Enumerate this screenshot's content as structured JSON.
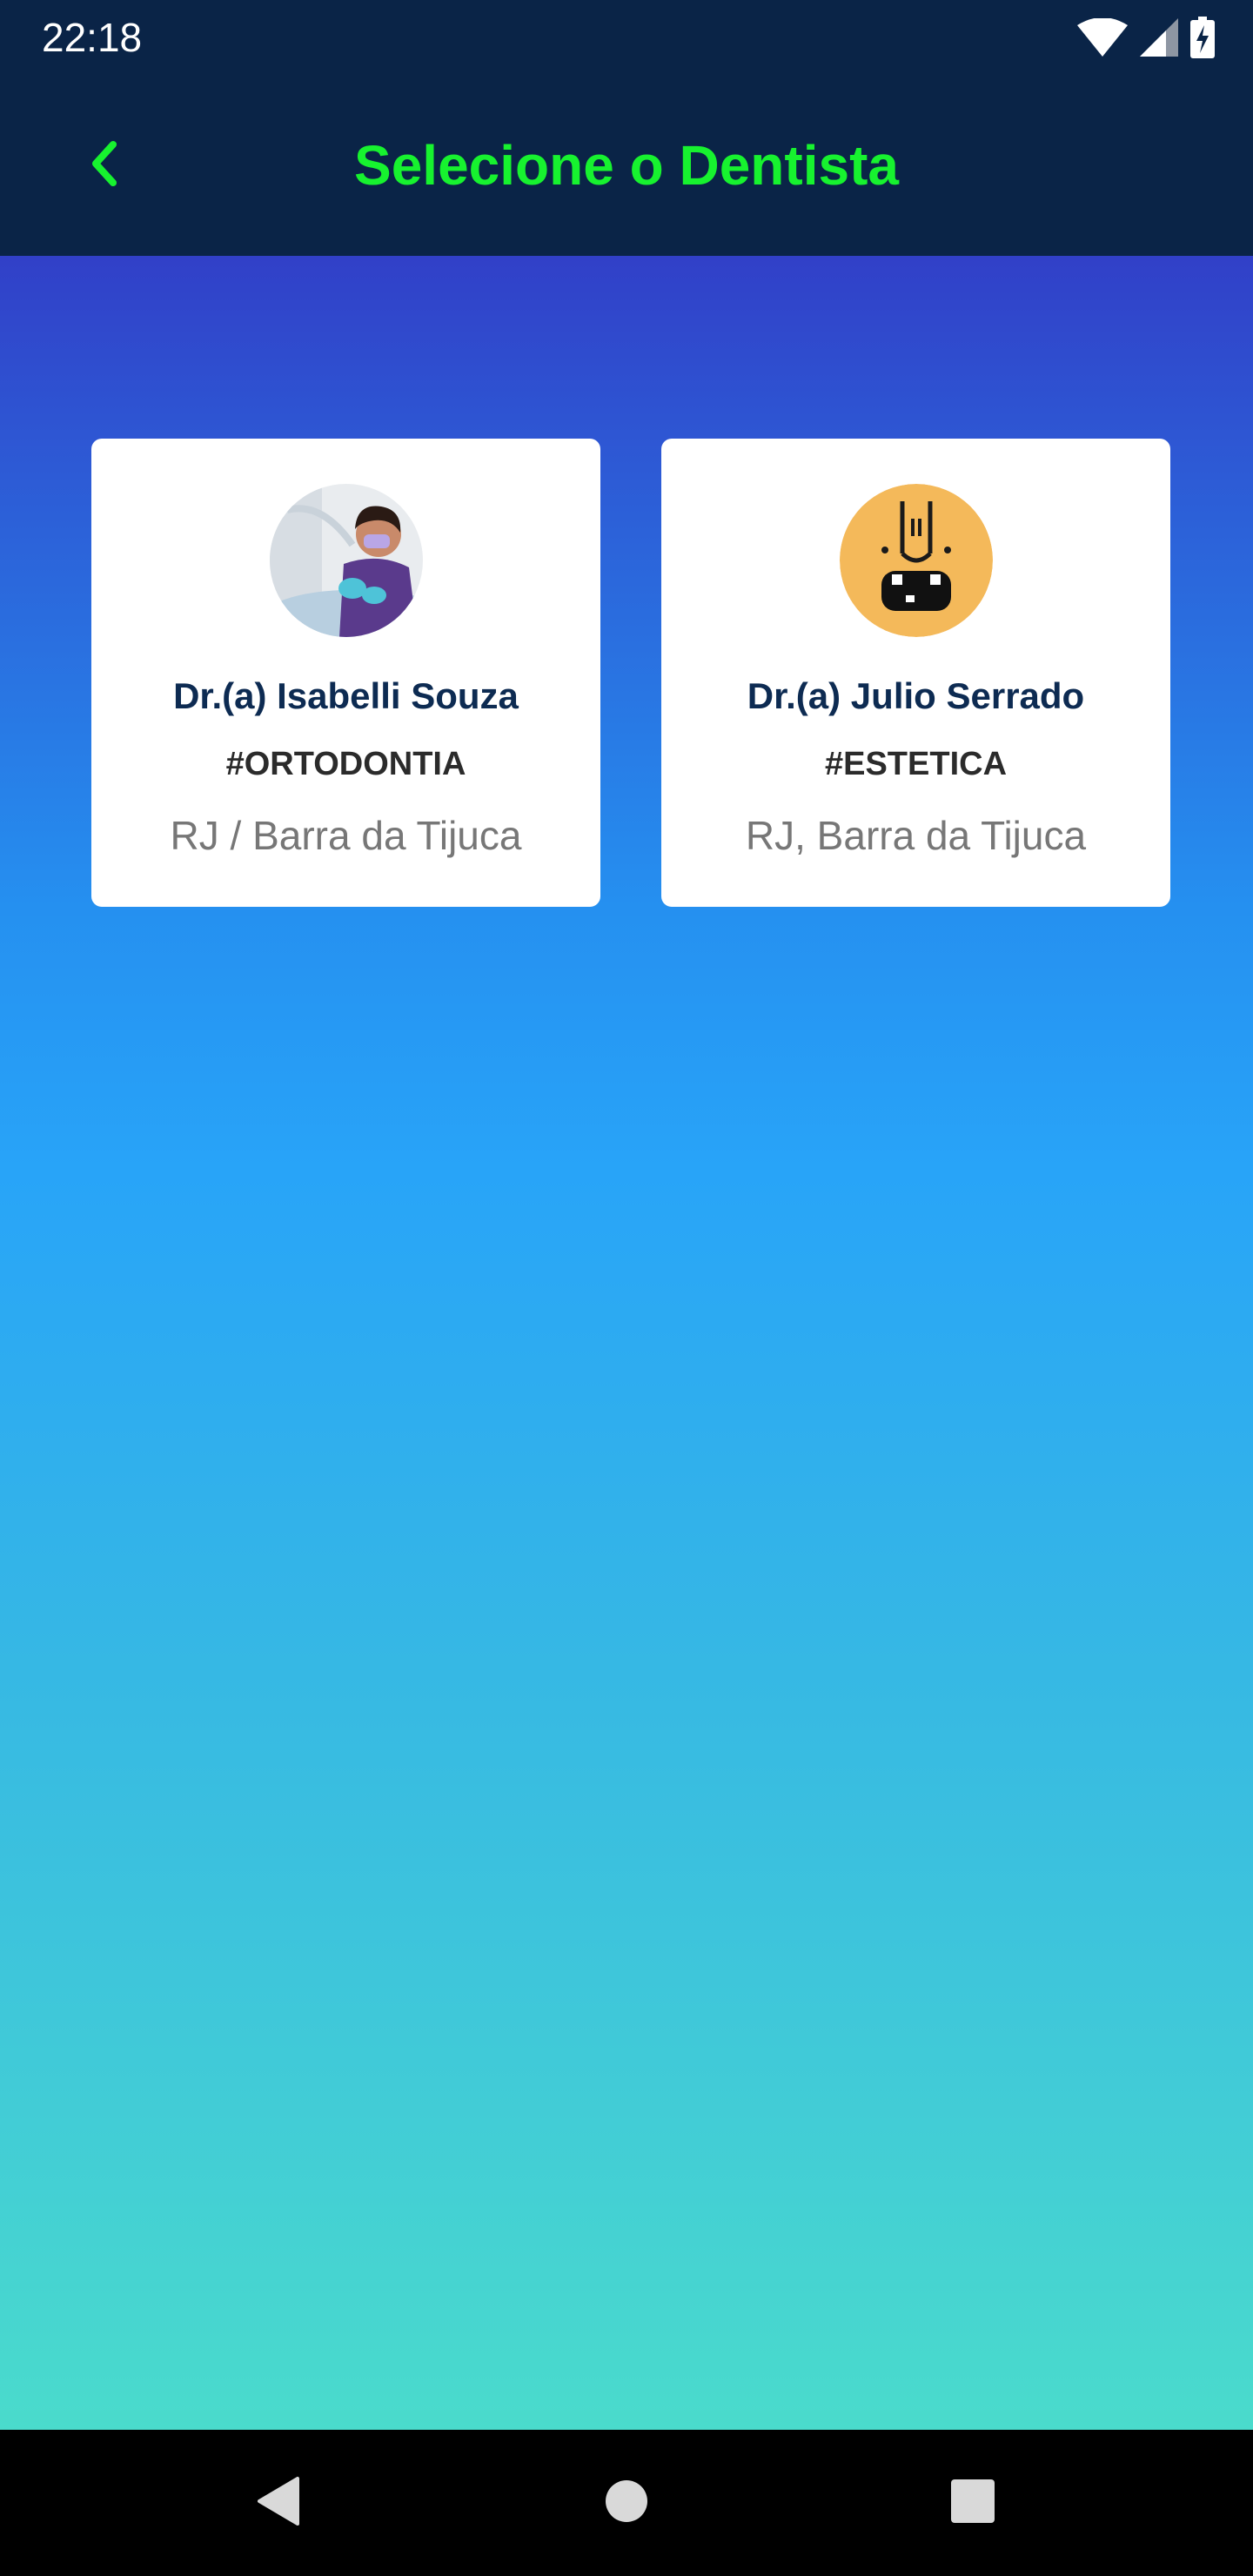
{
  "status_bar": {
    "time": "22:18",
    "icons": [
      "wifi-icon",
      "cellular-signal-icon",
      "battery-charging-icon"
    ]
  },
  "header": {
    "title": "Selecione o Dentista",
    "back_icon": "chevron-left-icon",
    "title_color": "#17f22f",
    "background_color": "#0a2447"
  },
  "dentists": [
    {
      "name": "Dr.(a) Isabelli Souza",
      "specialty": "#ORTODONTIA",
      "location": "RJ / Barra da Tijuca",
      "avatar": "dentist-photo"
    },
    {
      "name": "Dr.(a) Julio Serrado",
      "specialty": "#ESTETICA",
      "location": "RJ, Barra da Tijuca",
      "avatar": "cartoon-face-illustration"
    }
  ],
  "nav_bar": {
    "buttons": [
      "back-triangle-icon",
      "home-circle-icon",
      "recents-square-icon"
    ]
  },
  "colors": {
    "gradient_top": "#3140c8",
    "gradient_bottom": "#4adbcc"
  }
}
